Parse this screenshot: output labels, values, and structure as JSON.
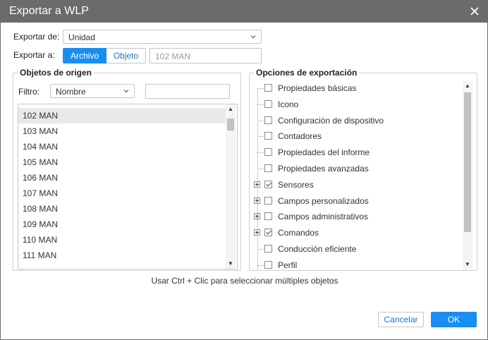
{
  "dialog": {
    "title": "Exportar a WLP",
    "close_icon": "close-icon"
  },
  "export_from": {
    "label": "Exportar de:",
    "value": "Unidad"
  },
  "export_to": {
    "label": "Exportar a:",
    "options": [
      "Archivo",
      "Objeto"
    ],
    "active": "Archivo",
    "target_placeholder": "102 MAN"
  },
  "source": {
    "legend": "Objetos de origen",
    "filter_label": "Filtro:",
    "filter_value": "Nombre",
    "search_value": "",
    "items": [
      "102 MAN",
      "103 MAN",
      "104 MAN",
      "105 MAN",
      "106 MAN",
      "107 MAN",
      "108 MAN",
      "109 MAN",
      "110 MAN",
      "111 MAN"
    ],
    "selected": "102 MAN"
  },
  "options": {
    "legend": "Opciones de exportación",
    "items": [
      {
        "label": "Propiedades básicas",
        "checked": false,
        "expandable": false
      },
      {
        "label": "Icono",
        "checked": false,
        "expandable": false
      },
      {
        "label": "Configuración de dispositivo",
        "checked": false,
        "expandable": false
      },
      {
        "label": "Contadores",
        "checked": false,
        "expandable": false
      },
      {
        "label": "Propiedades del informe",
        "checked": false,
        "expandable": false
      },
      {
        "label": "Propiedades avanzadas",
        "checked": false,
        "expandable": false
      },
      {
        "label": "Sensores",
        "checked": true,
        "expandable": true
      },
      {
        "label": "Campos personalizados",
        "checked": false,
        "expandable": true
      },
      {
        "label": "Campos administrativos",
        "checked": false,
        "expandable": true
      },
      {
        "label": "Comandos",
        "checked": true,
        "expandable": true
      },
      {
        "label": "Conducción eficiente",
        "checked": false,
        "expandable": false
      },
      {
        "label": "Perfil",
        "checked": false,
        "expandable": false
      }
    ]
  },
  "hint": "Usar Ctrl + Clic para seleccionar múltiples objetos",
  "buttons": {
    "cancel": "Cancelar",
    "ok": "OK"
  },
  "colors": {
    "titlebar": "#6b6b6b",
    "accent": "#1a8ef0",
    "link": "#2273c7"
  }
}
